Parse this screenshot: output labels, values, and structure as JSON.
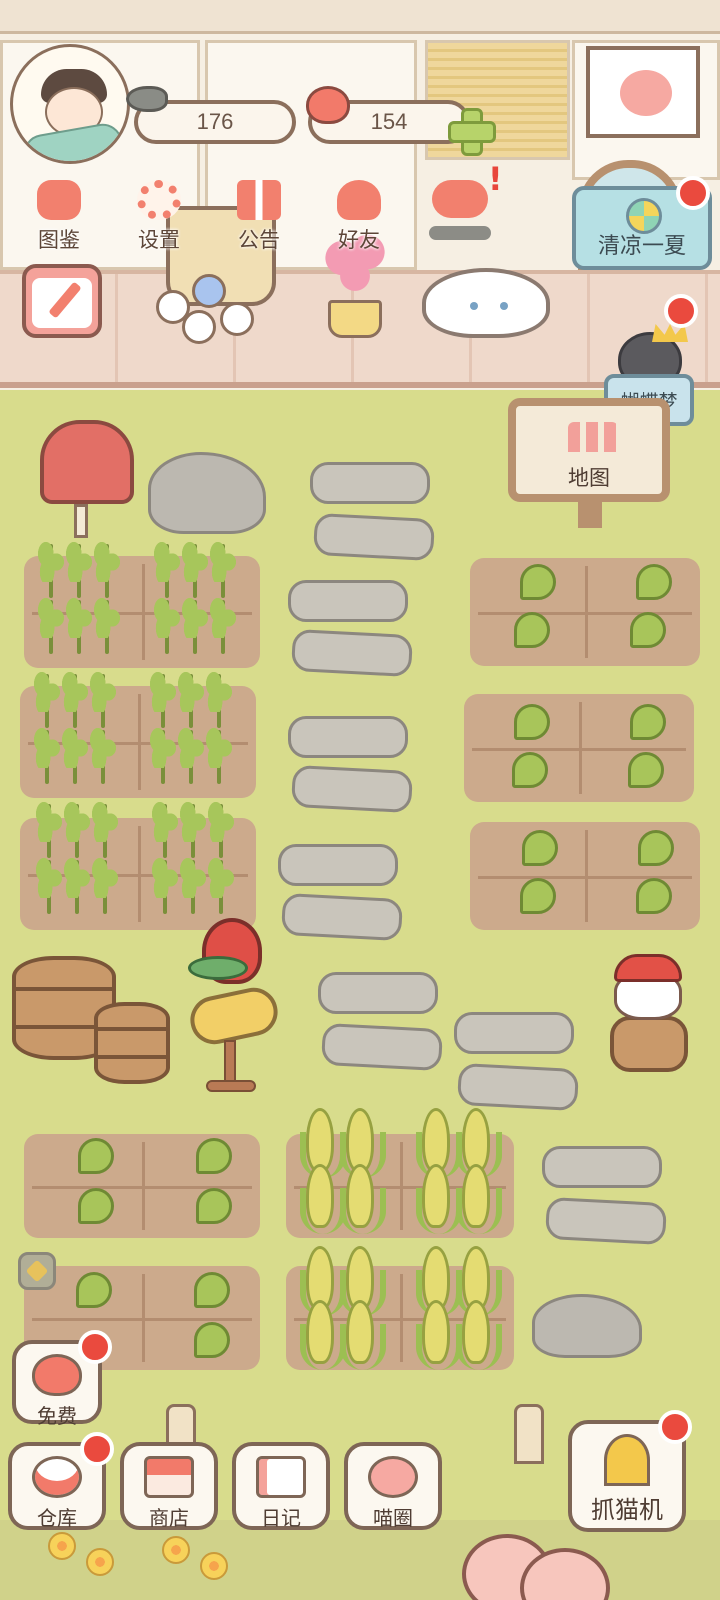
{
  "currency": {
    "fish_count": "176",
    "heart_count": "154"
  },
  "top_menu": [
    {
      "label": "图鉴",
      "icon": "cat-book-icon"
    },
    {
      "label": "设置",
      "icon": "gear-icon"
    },
    {
      "label": "公告",
      "icon": "gift-icon"
    },
    {
      "label": "好友",
      "icon": "friends-icon"
    }
  ],
  "events": {
    "summer_event_label": "清凉一夏",
    "butterfly_dream_label": "蝴蝶梦"
  },
  "map_sign": {
    "label": "地图"
  },
  "bottom_left": {
    "free_label": "免费"
  },
  "bottom_nav": [
    {
      "label": "仓库",
      "icon": "storage-icon"
    },
    {
      "label": "商店",
      "icon": "shop-icon"
    },
    {
      "label": "日记",
      "icon": "diary-icon"
    },
    {
      "label": "喵圈",
      "icon": "cat-planet-icon"
    }
  ],
  "claw_machine": {
    "label": "抓猫机"
  },
  "colors": {
    "grass": "#d8dc8c",
    "soil": "#ccaa8c",
    "accent_red": "#ea4a3e",
    "coral": "#f2806e",
    "border_brown": "#7e6656"
  }
}
